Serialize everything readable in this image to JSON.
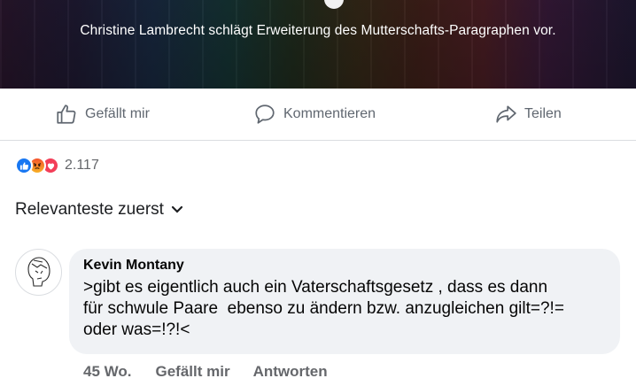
{
  "post": {
    "caption": "Christine Lambrecht schlägt Erweiterung des Mutterschafts-Paragraphen vor."
  },
  "actions": {
    "like": "Gefällt mir",
    "comment": "Kommentieren",
    "share": "Teilen"
  },
  "reactions": {
    "icons": [
      "like-icon",
      "angry-icon",
      "love-icon"
    ],
    "count": "2.117"
  },
  "sort": {
    "label": "Relevanteste zuerst"
  },
  "comment": {
    "author": "Kevin Montany",
    "text": ">gibt es eigentlich auch ein Vaterschaftsgesetz , dass es dann\nfür schwule Paare  ebenso zu ändern bzw. anzugleichen gilt=?!=\noder was=!?!<",
    "time": "45 Wo.",
    "like": "Gefällt mir",
    "reply": "Antworten"
  },
  "colors": {
    "accent": "#1877f2",
    "bubble": "#f0f2f5",
    "muted": "#65676b"
  }
}
